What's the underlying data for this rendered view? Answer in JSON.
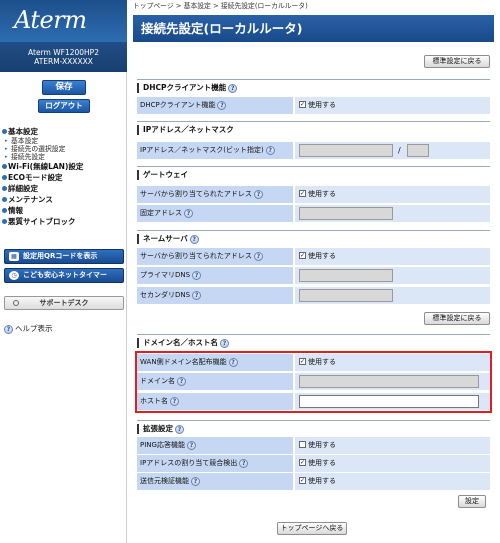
{
  "sidebar": {
    "logo": "Aterm",
    "model_line1": "Aterm WF1200HP2",
    "model_line2": "ATERM-XXXXXX",
    "save_label": "保存",
    "logout_label": "ログアウト",
    "nav": {
      "basic": "基本設定",
      "basic_sub1": "基本設定",
      "basic_sub2": "接続先の選択設定",
      "basic_sub3": "接続先設定",
      "wifi": "Wi-Fi(無線LAN)設定",
      "eco": "ECOモード設定",
      "detail": "詳細設定",
      "maintenance": "メンテナンス",
      "info": "情報",
      "block": "悪質サイトブロック"
    },
    "qr_label": "設定用QRコードを表示",
    "kids_label": "こども安心ネットタイマー",
    "support_label": "サポートデスク",
    "help_label": "ヘルプ表示"
  },
  "main": {
    "breadcrumb": "トップページ > 基本設定 > 接続先設定(ローカルルータ)",
    "title": "接続先設定(ローカルルータ)",
    "reset_default_label": "標準設定に戻る",
    "dhcp": {
      "title": "DHCPクライアント機能",
      "row_label": "DHCPクライアント機能",
      "use_label": "使用する"
    },
    "ip": {
      "title": "IPアドレス／ネットマスク",
      "row_label": "IPアドレス／ネットマスク(ビット指定)",
      "slash": "/"
    },
    "gateway": {
      "title": "ゲートウェイ",
      "row1_label": "サーバから割り当てられたアドレス",
      "row1_use": "使用する",
      "row2_label": "固定アドレス"
    },
    "dns": {
      "title": "ネームサーバ",
      "row1_label": "サーバから割り当てられたアドレス",
      "row1_use": "使用する",
      "row2_label": "プライマリDNS",
      "row3_label": "セカンダリDNS",
      "reset_label": "標準設定に戻る"
    },
    "domain": {
      "title": "ドメイン名／ホスト名",
      "row1_label": "WAN側ドメイン名配布機能",
      "row1_use": "使用する",
      "row2_label": "ドメイン名",
      "row3_label": "ホスト名"
    },
    "ext": {
      "title": "拡張設定",
      "row1_label": "PING応答機能",
      "row1_use": "使用する",
      "row2_label": "IPアドレスの割り当て競合検出",
      "row2_use": "使用する",
      "row3_label": "送信元検証機能",
      "row3_use": "使用する"
    },
    "set_label": "設定",
    "back_top_label": "トップページへ戻る"
  },
  "colors": {
    "header_blue": "#184a8a",
    "label_cell": "#c5d7f2",
    "value_cell": "#dbe7f7",
    "highlight": "#e02020"
  }
}
